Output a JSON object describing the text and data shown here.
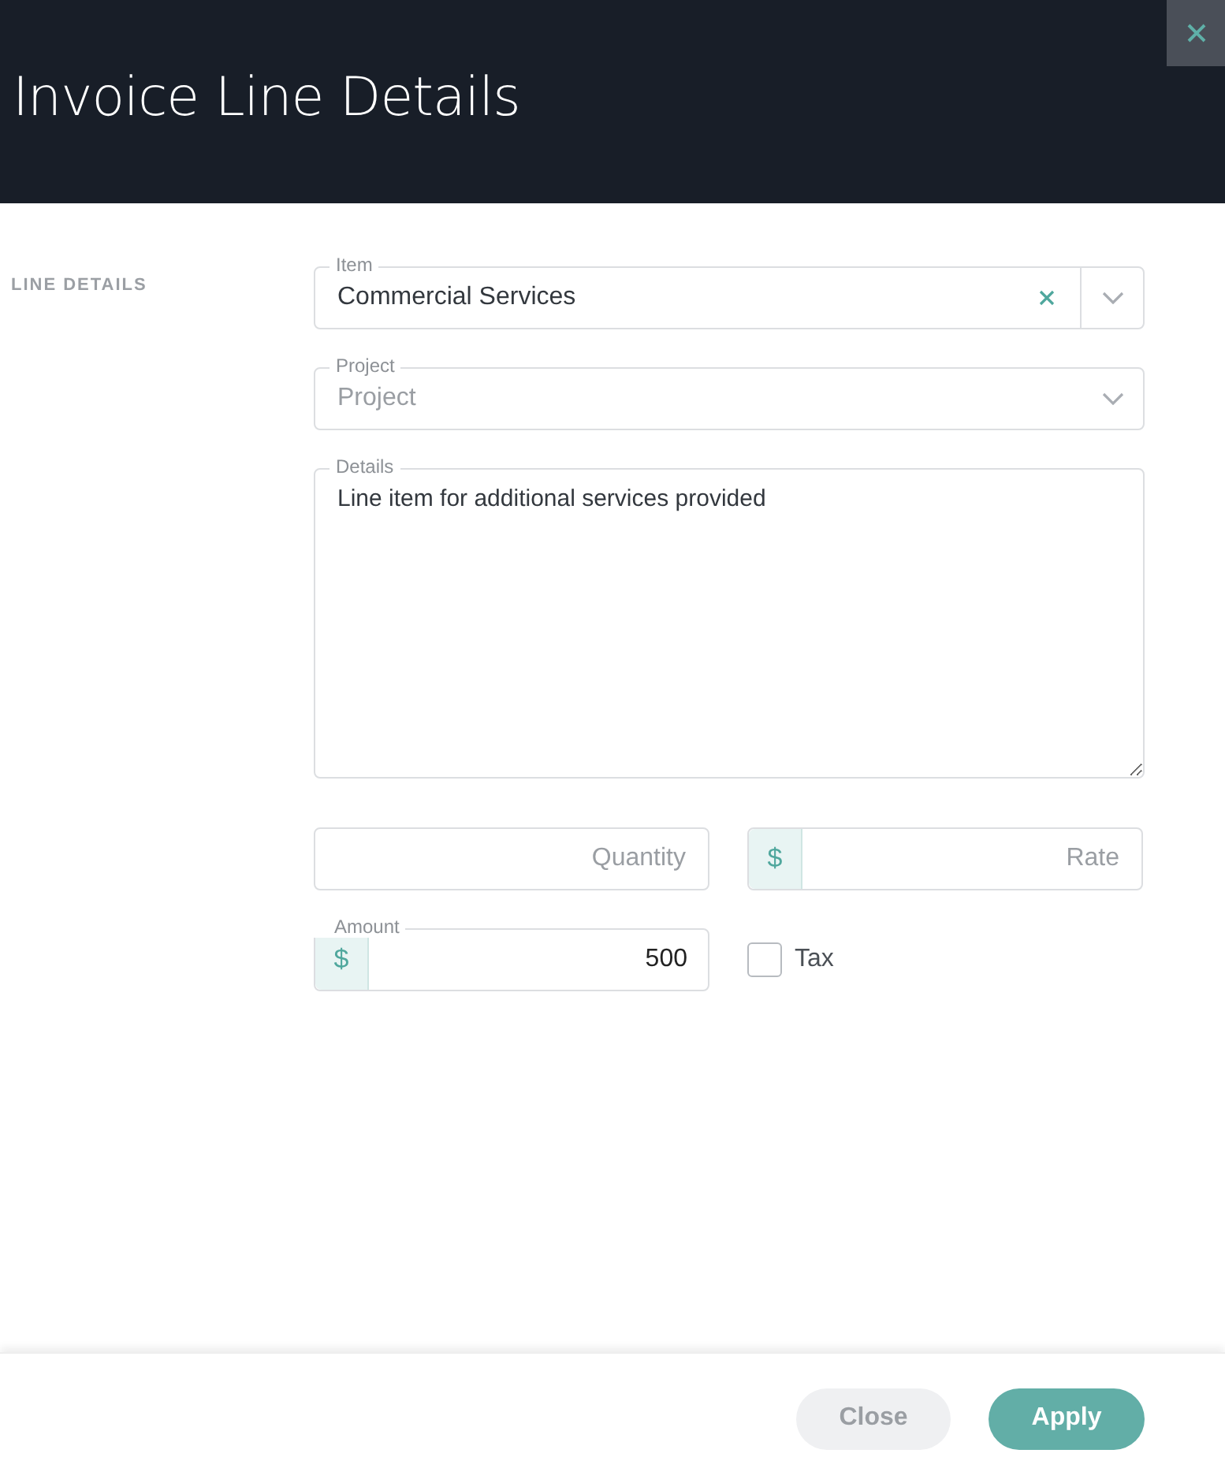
{
  "header": {
    "title": "Invoice Line Details"
  },
  "section": {
    "label": "LINE DETAILS"
  },
  "item": {
    "label": "Item",
    "value": "Commercial Services",
    "clearable": true
  },
  "project": {
    "label": "Project",
    "placeholder": "Project"
  },
  "details": {
    "label": "Details",
    "value": "Line item for additional services provided"
  },
  "quantity": {
    "placeholder": "Quantity"
  },
  "rate": {
    "prefix": "$",
    "placeholder": "Rate"
  },
  "amount": {
    "label": "Amount",
    "prefix": "$",
    "value": "500"
  },
  "tax": {
    "label": "Tax",
    "checked": false
  },
  "buttons": [
    {
      "label": "Close",
      "kind": "secondary"
    },
    {
      "label": "Apply",
      "kind": "primary"
    }
  ]
}
